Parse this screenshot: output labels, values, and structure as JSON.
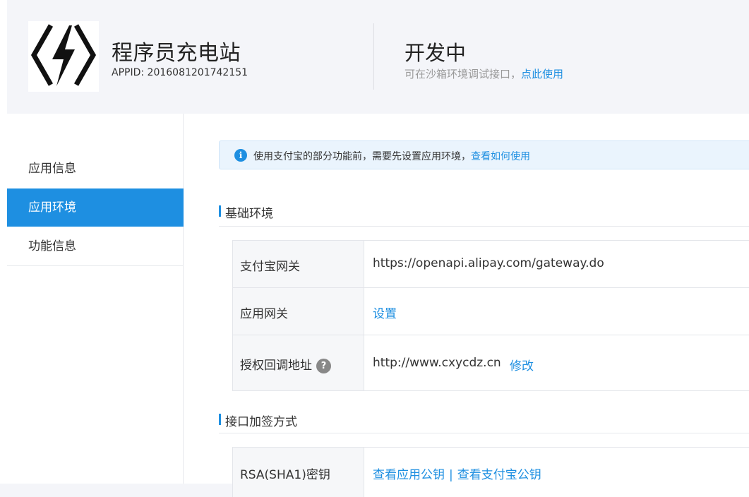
{
  "header": {
    "app_name": "程序员充电站",
    "app_id": "APPID: 2016081201742151",
    "status_title": "开发中",
    "status_desc": "可在沙箱环境调试接口，",
    "status_link": "点此使用"
  },
  "sidebar": {
    "items": [
      {
        "label": "应用信息"
      },
      {
        "label": "应用环境"
      },
      {
        "label": "功能信息"
      }
    ]
  },
  "notice": {
    "text": "使用支付宝的部分功能前，需要先设置应用环境，",
    "link": "查看如何使用"
  },
  "basic_env": {
    "title": "基础环境",
    "rows": {
      "gateway": {
        "label": "支付宝网关",
        "value": "https://openapi.alipay.com/gateway.do"
      },
      "app_gateway": {
        "label": "应用网关",
        "link": "设置"
      },
      "callback": {
        "label": "授权回调地址",
        "help": "?",
        "value": "http://www.cxycdz.cn",
        "link": "修改"
      }
    }
  },
  "sign_method": {
    "title": "接口加签方式",
    "rows": {
      "rsa": {
        "label": "RSA(SHA1)密钥",
        "link_app": "查看应用公钥",
        "separator": "|",
        "link_alipay": "查看支付宝公钥"
      }
    }
  },
  "colors": {
    "accent": "#1e8fe1",
    "background": "#f4f5f9"
  }
}
